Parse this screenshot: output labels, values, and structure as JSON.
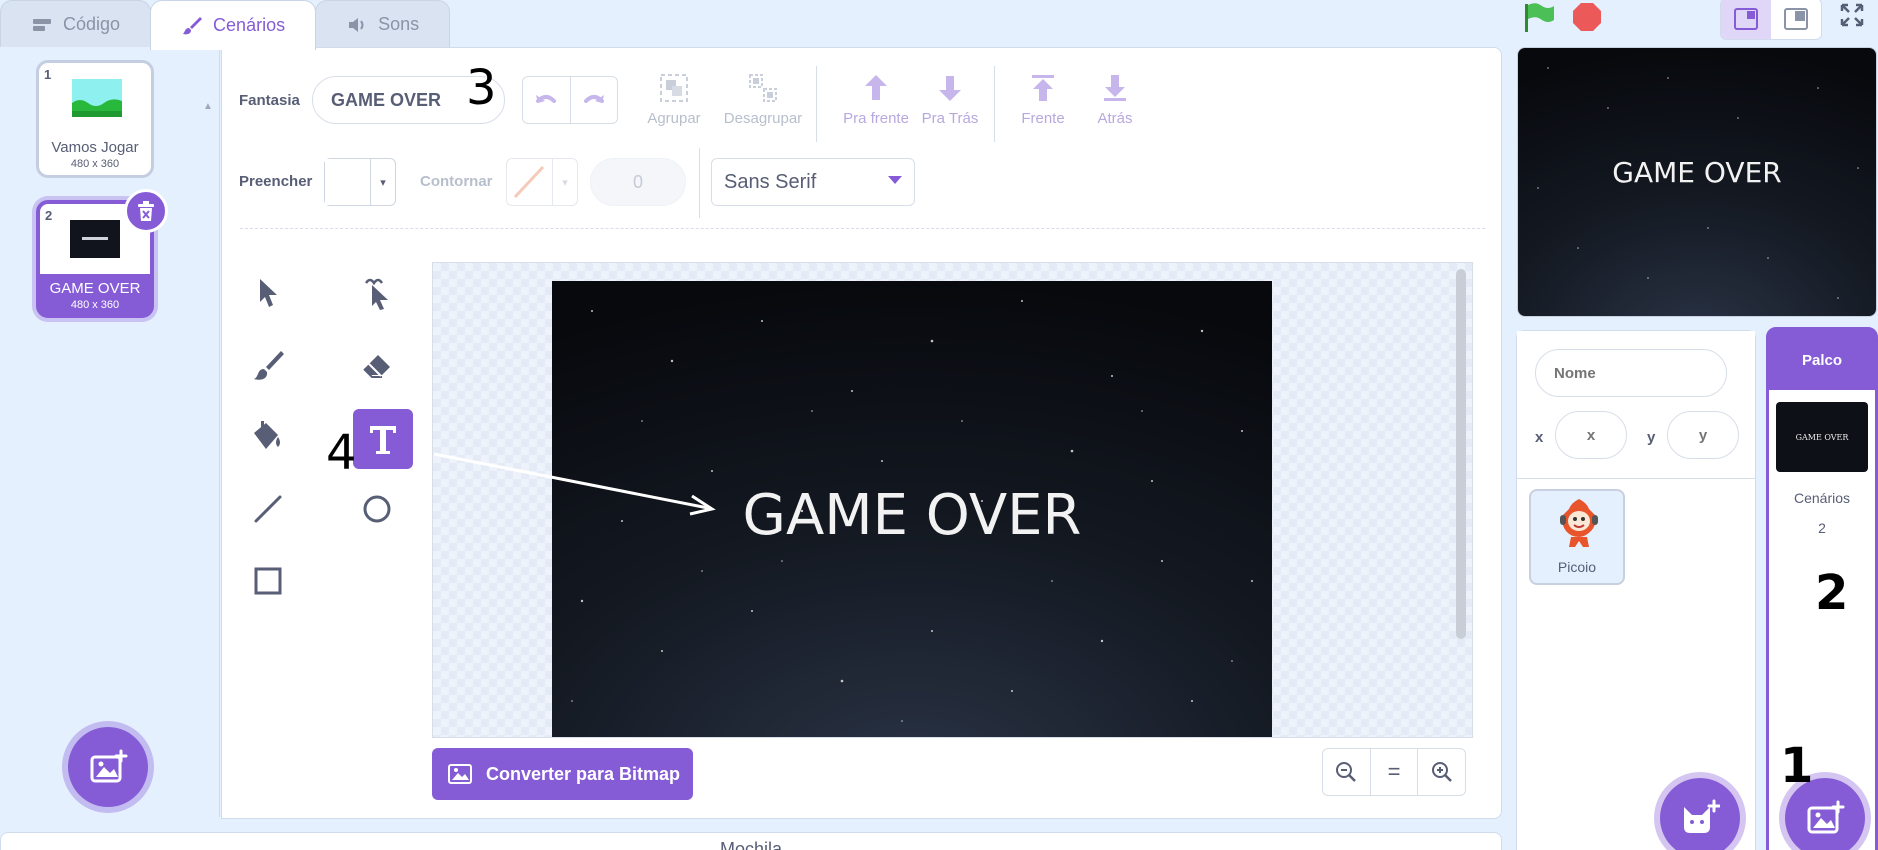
{
  "tabs": [
    {
      "label": "Código",
      "icon": "code-icon"
    },
    {
      "label": "Cenários",
      "icon": "brush-icon"
    },
    {
      "label": "Sons",
      "icon": "speaker-icon"
    }
  ],
  "costumes": [
    {
      "number": "1",
      "name": "Vamos Jogar",
      "size": "480 x 360"
    },
    {
      "number": "2",
      "name": "GAME OVER",
      "size": "480 x 360"
    }
  ],
  "toolbar": {
    "costume_label": "Fantasia",
    "costume_name": "GAME OVER",
    "group_label": "Agrupar",
    "ungroup_label": "Desagrupar",
    "forward_label": "Pra frente",
    "backward_label": "Pra Trás",
    "front_label": "Frente",
    "back_label": "Atrás",
    "fill_label": "Preencher",
    "outline_label": "Contornar",
    "outline_width": "0",
    "font": "Sans Serif"
  },
  "canvas": {
    "text": "GAME OVER"
  },
  "bitmap_button": "Converter para Bitmap",
  "zoom": {
    "reset": "="
  },
  "stage": {
    "text": "GAME OVER"
  },
  "sprite_info": {
    "name_placeholder": "Nome",
    "x_label": "x",
    "x_placeholder": "x",
    "y_label": "y",
    "y_placeholder": "y"
  },
  "sprites": [
    {
      "name": "Picoio"
    }
  ],
  "stage_selector": {
    "header": "Palco",
    "thumb_text": "GAME OVER",
    "backdrops_label": "Cenários",
    "backdrops_count": "2"
  },
  "backpack_label": "Mochila",
  "annotations": {
    "a1": "1",
    "a2": "2",
    "a3": "3",
    "a4": "4"
  },
  "colors": {
    "accent": "#855cd6",
    "text": "#575e75",
    "background": "#e5f0ff"
  }
}
